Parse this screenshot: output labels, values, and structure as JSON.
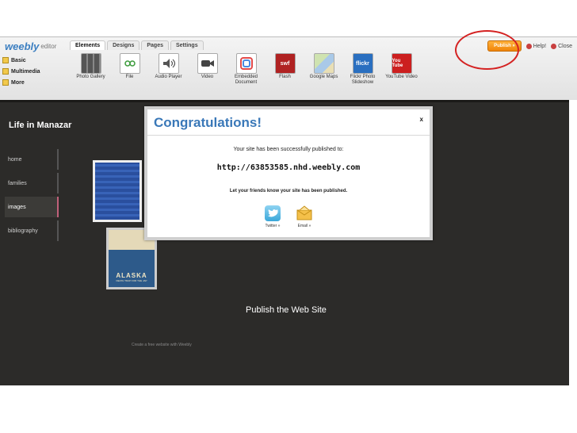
{
  "editor": {
    "brand": "weebly",
    "brand_sub": "editor",
    "tabs": [
      "Elements",
      "Designs",
      "Pages",
      "Settings"
    ],
    "publish_label": "Publish »",
    "help_label": "Help!",
    "close_label": "Close",
    "categories": [
      "Basic",
      "Multimedia",
      "More"
    ],
    "elements": [
      {
        "label": "Photo Gallery",
        "icon": "photo-gallery-icon"
      },
      {
        "label": "File",
        "icon": "file-icon"
      },
      {
        "label": "Audio Player",
        "icon": "audio-icon"
      },
      {
        "label": "Video",
        "icon": "video-icon"
      },
      {
        "label": "Embedded Document",
        "icon": "document-icon"
      },
      {
        "label": "Flash",
        "icon": "flash-icon",
        "glyph": "swf"
      },
      {
        "label": "Google Maps",
        "icon": "map-icon"
      },
      {
        "label": "Flickr Photo Slideshow",
        "icon": "flickr-icon",
        "glyph": "flickr"
      },
      {
        "label": "YouTube Video",
        "icon": "youtube-icon",
        "glyph": "You Tube"
      }
    ]
  },
  "site": {
    "title": "Life in Manazar",
    "nav": [
      "home",
      "families",
      "images",
      "bibliography"
    ],
    "active_nav": "images",
    "poster_text": "ALASKA",
    "poster_sub": "DEATH TRAP FOR THE JAP",
    "caption": "Publish the Web Site",
    "footer": "Create a free website with Weebly"
  },
  "modal": {
    "title": "Congratulations!",
    "close": "x",
    "message": "Your site has been successfully published to:",
    "url": "http://63853585.nhd.weebly.com",
    "share_prompt": "Let your friends know your site has been published.",
    "twitter_label": "Twitter »",
    "email_label": "Email »"
  },
  "colors": {
    "accent": "#3a78b8",
    "publish": "#f0850a",
    "highlight_ring": "#d42222",
    "site_bg": "#2c2b29"
  }
}
